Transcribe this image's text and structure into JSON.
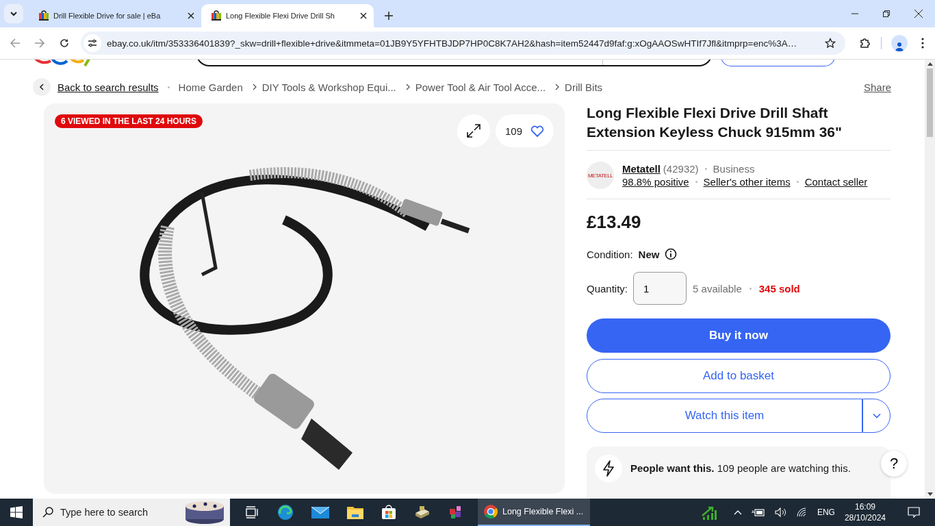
{
  "browser": {
    "tabs": [
      {
        "title": "Drill Flexible Drive for sale | eBa",
        "selected": false
      },
      {
        "title": "Long Flexible Flexi Drive Drill Sh",
        "selected": true
      }
    ],
    "url": "ebay.co.uk/itm/353336401839?_skw=drill+flexible+drive&itmmeta=01JB9Y5YFHTBJDP7HP0C8K7AH2&hash=item52447d9faf:g:xOgAAOSwHTIf7Jfl&itmprp=enc%3A…"
  },
  "breadcrumb": {
    "back": "Back to search results",
    "items": [
      "Home Garden",
      "DIY Tools & Workshop Equi...",
      "Power Tool & Air Tool Acce...",
      "Drill Bits"
    ],
    "share": "Share"
  },
  "gallery": {
    "badge": "6 VIEWED IN THE LAST 24 HOURS",
    "watch_count": "109"
  },
  "product": {
    "title": "Long Flexible Flexi Drive Drill Shaft Extension Keyless Chuck 915mm 36\"",
    "seller": {
      "logo": "METATELL",
      "name": "Metatell",
      "feedback": "(42932)",
      "type": "Business",
      "positive": "98.8% positive",
      "other_items": "Seller's other items",
      "contact": "Contact seller"
    },
    "price": "£13.49",
    "condition_label": "Condition:",
    "condition": "New",
    "quantity_label": "Quantity:",
    "quantity": "1",
    "available": "5 available",
    "sold": "345 sold",
    "buy": "Buy it now",
    "basket": "Add to basket",
    "watch": "Watch this item",
    "signal": "**People want this.** 109 people are watching this.",
    "help": "?"
  },
  "taskbar": {
    "search_placeholder": "Type here to search",
    "window": {
      "label": "Long Flexible Flexi ...",
      "active": true
    },
    "language": "ENG",
    "time": "16:09",
    "date": "28/10/2024"
  }
}
